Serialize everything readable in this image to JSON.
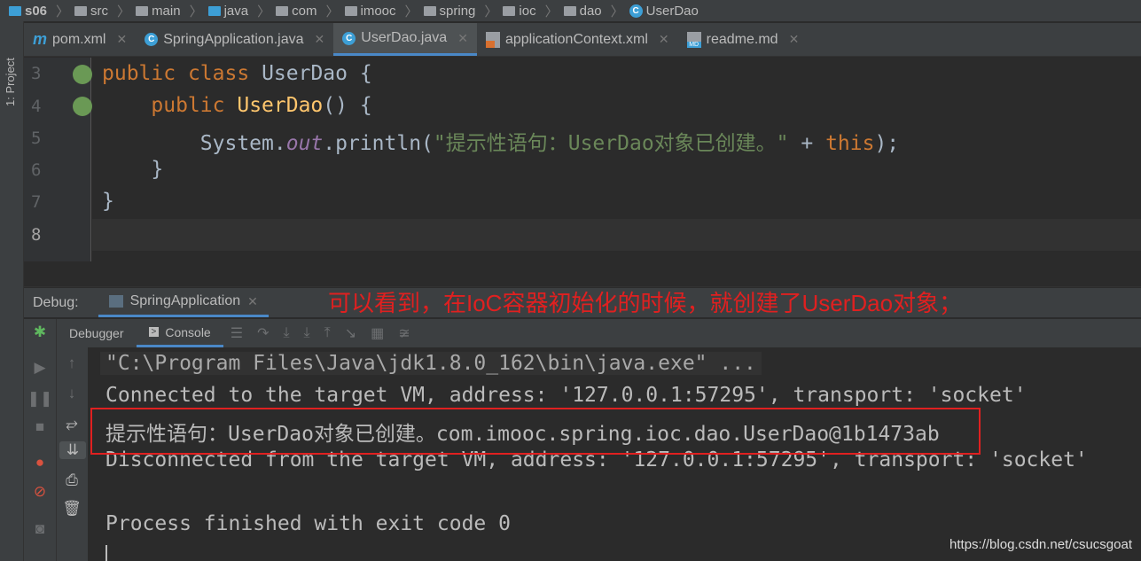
{
  "breadcrumb": [
    "s06",
    "src",
    "main",
    "java",
    "com",
    "imooc",
    "spring",
    "ioc",
    "dao",
    "UserDao"
  ],
  "sidebar": {
    "project_label": "1: Project"
  },
  "tabs": [
    {
      "label": "pom.xml",
      "icon": "maven-icon"
    },
    {
      "label": "SpringApplication.java",
      "icon": "class-icon"
    },
    {
      "label": "UserDao.java",
      "icon": "class-icon",
      "active": true
    },
    {
      "label": "applicationContext.xml",
      "icon": "xml-icon"
    },
    {
      "label": "readme.md",
      "icon": "markdown-icon"
    }
  ],
  "editor": {
    "line_numbers": [
      "3",
      "4",
      "5",
      "6",
      "7",
      "8"
    ],
    "lines": {
      "l3": {
        "kw1": "public",
        "kw2": "class",
        "name": "UserDao",
        "rest": " {"
      },
      "l4": {
        "kw1": "public",
        "name": "UserDao",
        "rest": "() {"
      },
      "l5": {
        "obj": "System.",
        "fld": "out",
        "call": ".println(",
        "str": "\"提示性语句：UserDao对象已创建。\"",
        "plus": " + ",
        "kw": "this",
        "end": ");"
      },
      "l6": "}",
      "l7": "}"
    }
  },
  "debug": {
    "label": "Debug:",
    "session": "SpringApplication",
    "tabs": {
      "debugger": "Debugger",
      "console": "Console"
    }
  },
  "annotation": "可以看到，在IoC容器初始化的时候，就创建了UserDao对象；",
  "console": {
    "lines": [
      "\"C:\\Program Files\\Java\\jdk1.8.0_162\\bin\\java.exe\" ...",
      "Connected to the target VM, address: '127.0.0.1:57295', transport: 'socket'",
      "提示性语句：UserDao对象已创建。com.imooc.spring.ioc.dao.UserDao@1b1473ab",
      "Disconnected from the target VM, address: '127.0.0.1:57295', transport: 'socket'",
      "Process finished with exit code 0"
    ]
  },
  "watermark": "https://blog.csdn.net/csucsgoat",
  "colors": {
    "keyword": "#cc7832",
    "string": "#6a8759",
    "method": "#ffc66d",
    "field": "#9876aa",
    "annotation": "#e02020"
  }
}
